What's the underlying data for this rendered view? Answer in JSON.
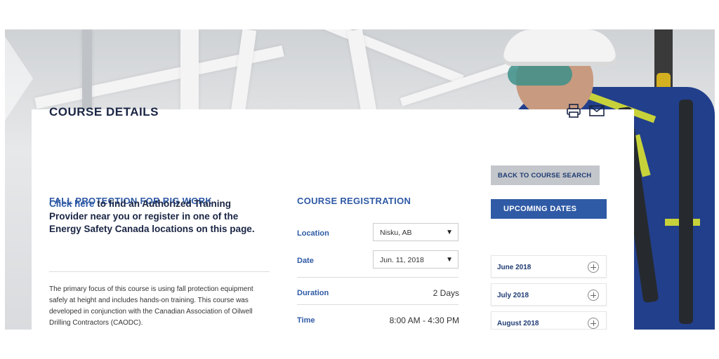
{
  "header": {
    "title": "COURSE DETAILS",
    "icons": [
      "printer-icon",
      "mail-icon"
    ]
  },
  "course": {
    "name": "FALL PROTECTION FOR RIG WORK",
    "lead_link": "Click here",
    "lead_rest": " to find an Authorized Training Provider near you or register in one of the Energy Safety Canada locations on this page.",
    "description": "The primary focus of this course is using fall protection equipment safely at height and includes hands-on training. This course was developed in conjunction with the Canadian Association of Oilwell Drilling Contractors (CAODC)."
  },
  "registration": {
    "title": "COURSE REGISTRATION",
    "location_label": "Location",
    "location_value": "Nisku, AB",
    "date_label": "Date",
    "date_value": "Jun. 11, 2018",
    "duration_label": "Duration",
    "duration_value": "2 Days",
    "time_label": "Time",
    "time_value": "8:00 AM - 4:30 PM",
    "dropdown_arrow": "▼"
  },
  "sidebar": {
    "back_label": "BACK TO COURSE SEARCH",
    "upcoming_label": "UPCOMING DATES",
    "months": [
      {
        "label": "June 2018"
      },
      {
        "label": "July 2018"
      },
      {
        "label": "August 2018"
      }
    ]
  },
  "colors": {
    "accent": "#2f5aa5",
    "heading": "#1a2544",
    "button_gray": "#c3c6ca"
  }
}
